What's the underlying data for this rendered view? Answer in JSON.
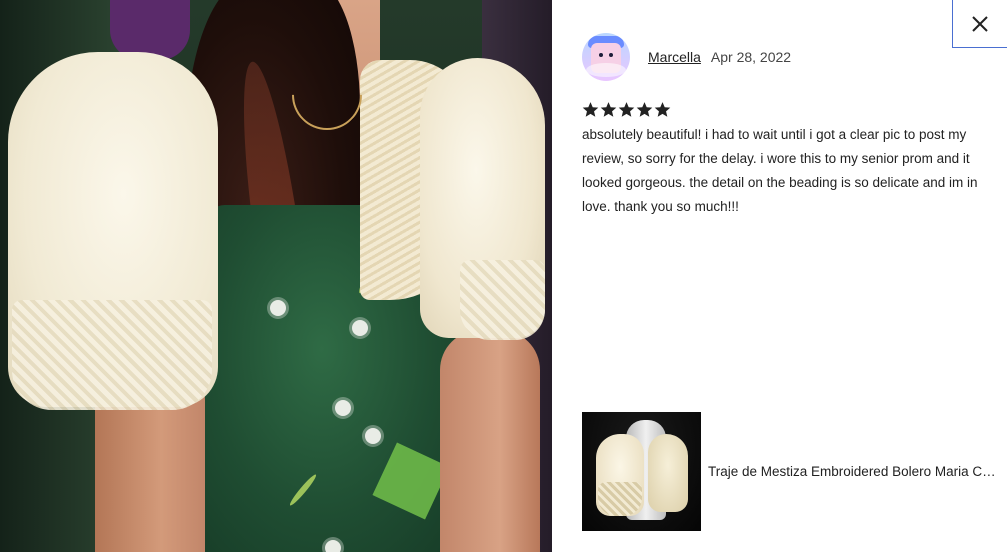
{
  "photo": {
    "alt_icon": "review-photo"
  },
  "close_button": {
    "icon": "close-icon",
    "color": "#222222",
    "border_color": "#4a6fd1"
  },
  "review": {
    "reviewer_name": "Marcella",
    "date": "Apr 28, 2022",
    "rating": 5,
    "rating_max": 5,
    "star_color": "#222222",
    "text": "absolutely beautiful! i had to wait until i got a clear pic to post my review, so sorry for the delay. i wore this to my senior prom and it looked gorgeous. the detail on the beading is so delicate and im in love. thank you so much!!!"
  },
  "product": {
    "title": "Traje de Mestiza Embroidered Bolero Maria Clara Piña Jusi Made to Order"
  }
}
